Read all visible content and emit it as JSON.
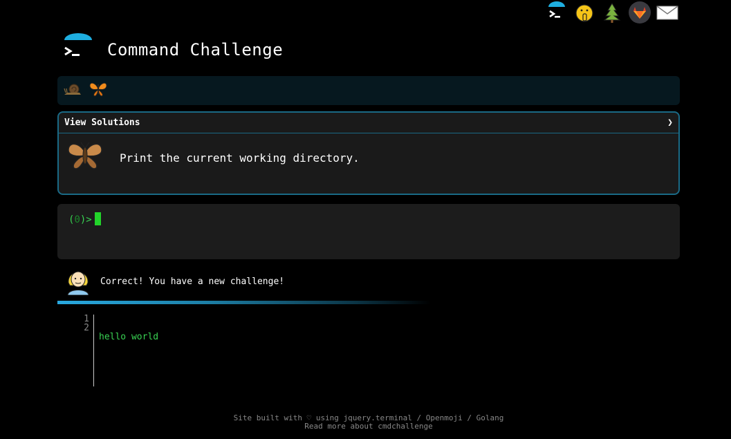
{
  "top_icons": [
    {
      "name": "cmdchallenge-icon",
      "label": "cmdchallenge"
    },
    {
      "name": "hint-icon",
      "label": "hint"
    },
    {
      "name": "tree-icon",
      "label": "tree"
    },
    {
      "name": "gitlab-icon",
      "label": "gitlab"
    },
    {
      "name": "email-icon",
      "label": "email"
    }
  ],
  "header": {
    "title": "Command Challenge"
  },
  "badges": [
    "snail-icon",
    "butterfly-icon"
  ],
  "challenge": {
    "solutions_label": "View Solutions",
    "solutions_chevron": "❯",
    "description": "Print the current working directory."
  },
  "terminal": {
    "prompt_open": "(",
    "prompt_num": "0",
    "prompt_close": ")>"
  },
  "feedback": {
    "message": "Correct! You have a new challenge!"
  },
  "output": {
    "line_numbers": [
      "1",
      "2"
    ],
    "lines": [
      "hello world",
      ""
    ]
  },
  "footer": {
    "line1_prefix": "Site built with ♡ using ",
    "link_jquery": "jquery.terminal",
    "sep1": " / ",
    "link_openmoji": "Openmoji",
    "sep2": " / ",
    "link_golang": "Golang",
    "line2": "Read more about cmdchallenge"
  },
  "colors": {
    "accent": "#1a6a86",
    "prompt_green": "#39d353",
    "cursor_green": "#22d42a",
    "progress_blue": "#29a9e0"
  }
}
